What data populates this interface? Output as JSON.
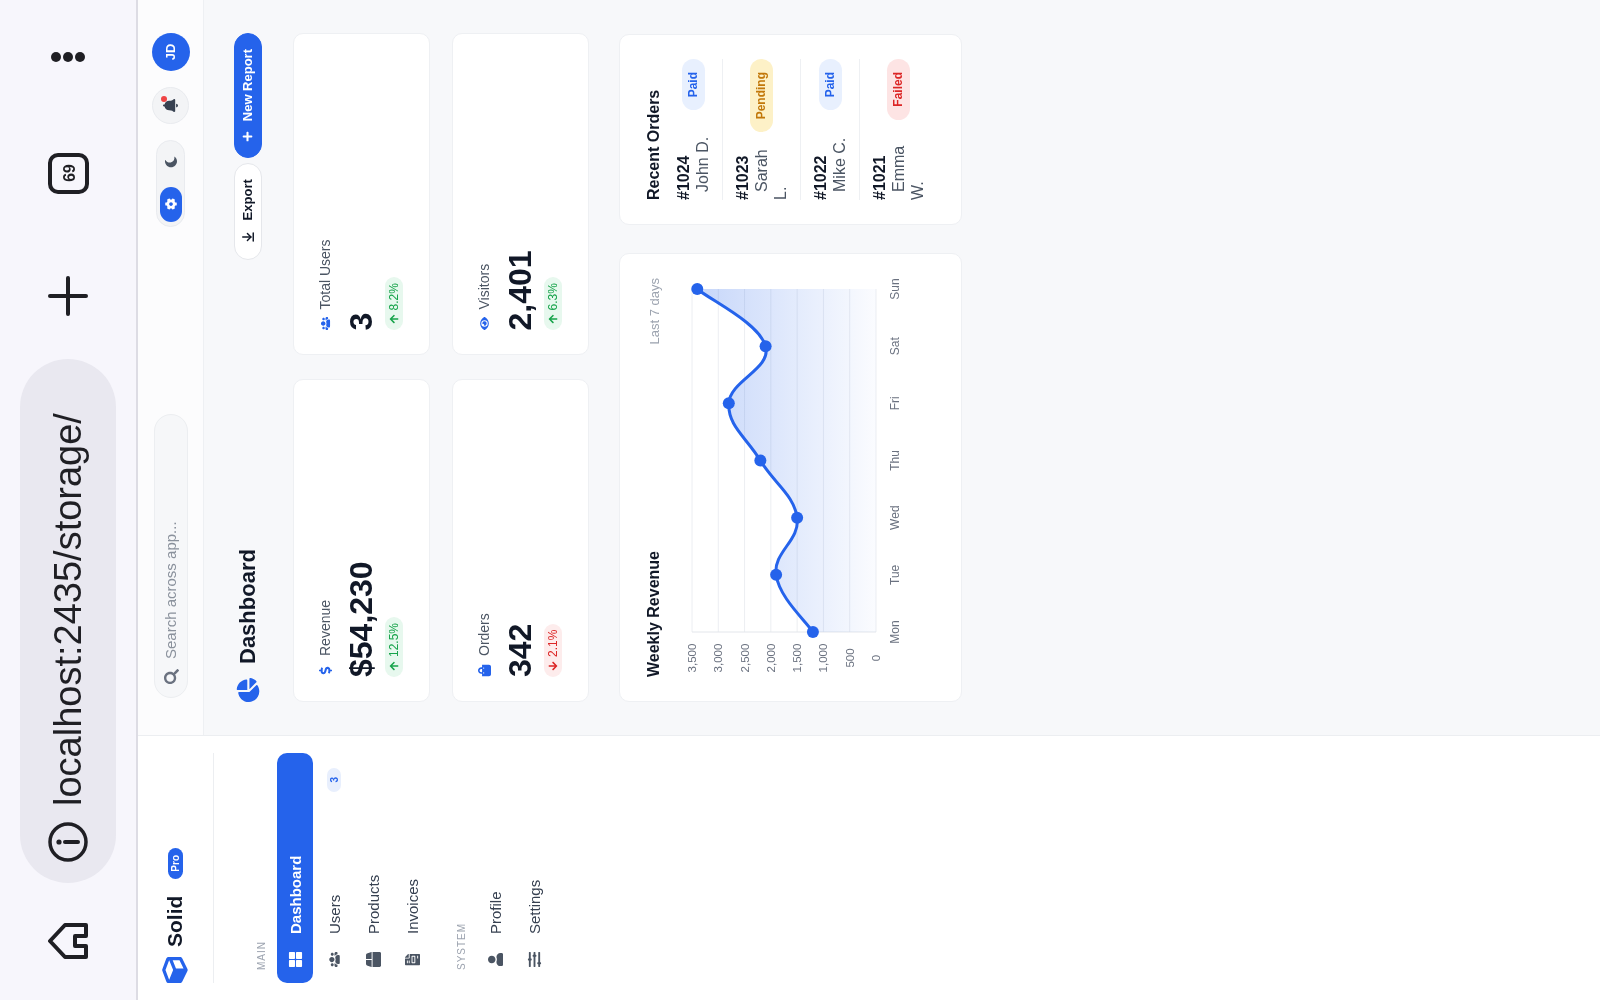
{
  "browser": {
    "url": "localhost:2435/storage/",
    "tab_count": "69"
  },
  "sidebar": {
    "brand": {
      "name": "Solid",
      "badge": "Pro"
    },
    "sections": [
      {
        "label": "MAIN",
        "items": [
          {
            "label": "Dashboard",
            "selected": true
          },
          {
            "label": "Users",
            "selected": false,
            "badge": "3"
          },
          {
            "label": "Products",
            "selected": false
          },
          {
            "label": "Invoices",
            "selected": false
          }
        ]
      },
      {
        "label": "SYSTEM",
        "items": [
          {
            "label": "Profile",
            "selected": false
          },
          {
            "label": "Settings",
            "selected": false
          }
        ]
      }
    ]
  },
  "header": {
    "search": {
      "placeholder": "Search across app..."
    },
    "theme_toggle": [
      {
        "selected": true
      },
      {
        "selected": false
      }
    ],
    "notifications": {
      "unread": true
    },
    "avatar": "JD"
  },
  "page": {
    "title": "Dashboard",
    "actions": [
      {
        "label": "Export",
        "kind": "secondary"
      },
      {
        "label": "New Report",
        "kind": "primary"
      }
    ]
  },
  "stats": [
    {
      "label": "Revenue",
      "value": "$54,230",
      "change": "12.5%",
      "kind": "up"
    },
    {
      "label": "Total Users",
      "value": "3",
      "change": "8.2%",
      "kind": "up"
    },
    {
      "label": "Orders",
      "value": "342",
      "change": "2.1%",
      "kind": "down"
    },
    {
      "label": "Visitors",
      "value": "2,401",
      "change": "6.3%",
      "kind": "up"
    }
  ],
  "weekly_revenue": {
    "subtitle": "Last 7 days",
    "chart_data": {
      "type": "area",
      "title": "Weekly Revenue",
      "orientation": "horizontal",
      "grid": true,
      "categories": [
        "Sun",
        "Sat",
        "Fri",
        "Thu",
        "Wed",
        "Tue",
        "Mon"
      ],
      "series": [
        {
          "color": "#2563eb",
          "values": [
            3400,
            2100,
            2800,
            2200,
            1500,
            1900,
            1200
          ]
        }
      ],
      "xlim": [
        3500,
        0
      ],
      "xticks": [
        {
          "value": 3500,
          "label": "3,500"
        },
        {
          "value": 3000,
          "label": "3,000"
        },
        {
          "value": 2500,
          "label": "2,500"
        },
        {
          "value": 2000,
          "label": "2,000"
        },
        {
          "value": 1500,
          "label": "1,500"
        },
        {
          "value": 1000,
          "label": "1,000"
        },
        {
          "value": 500,
          "label": "500"
        },
        {
          "value": 0,
          "label": "0"
        }
      ]
    }
  },
  "recent_orders": {
    "title": "Recent Orders",
    "orders": [
      {
        "id": "#1024",
        "customer": "John D.",
        "status": "Paid",
        "kind": "paid"
      },
      {
        "id": "#1023",
        "customer": "Sarah L.",
        "status": "Pending",
        "kind": "pending"
      },
      {
        "id": "#1022",
        "customer": "Mike C.",
        "status": "Paid",
        "kind": "paid"
      },
      {
        "id": "#1021",
        "customer": "Emma W.",
        "status": "Failed",
        "kind": "failed"
      }
    ]
  }
}
